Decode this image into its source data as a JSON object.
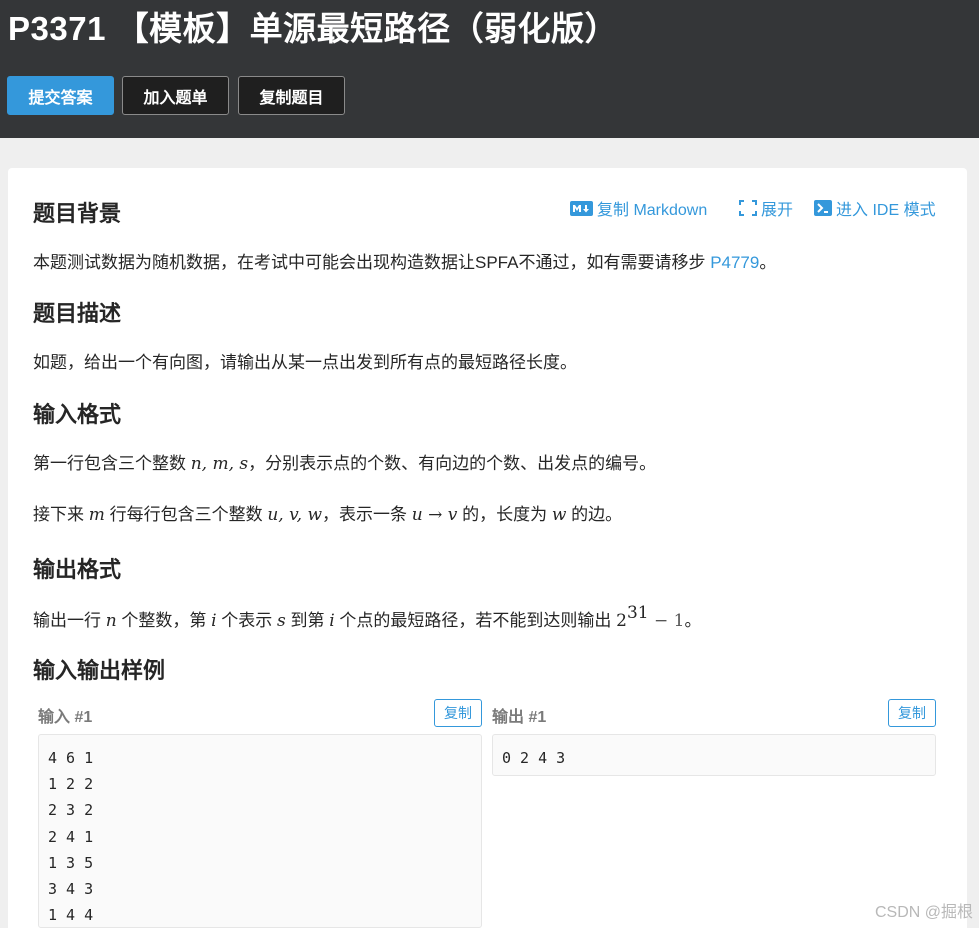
{
  "header": {
    "title": "P3371 【模板】单源最短路径（弱化版）",
    "buttons": {
      "submit": "提交答案",
      "add_to_list": "加入题单",
      "copy_problem": "复制题目"
    }
  },
  "toolbar": {
    "copy_markdown": "复制 Markdown",
    "expand": "展开",
    "ide_mode": "进入 IDE 模式"
  },
  "sections": {
    "background": {
      "heading": "题目背景",
      "text": "本题测试数据为随机数据，在考试中可能会出现构造数据让SPFA不通过，如有需要请移步 ",
      "link": "P4779",
      "end": "。"
    },
    "description": {
      "heading": "题目描述",
      "text": "如题，给出一个有向图，请输出从某一点出发到所有点的最短路径长度。"
    },
    "input_format": {
      "heading": "输入格式",
      "line1": {
        "pre": "第一行包含三个整数 ",
        "math": "n, m, s",
        "post": "，分别表示点的个数、有向边的个数、出发点的编号。"
      },
      "line2": {
        "pre": "接下来 ",
        "m": "m",
        "mid1": " 行每行包含三个整数 ",
        "uvw": "u, v, w",
        "mid2": "，表示一条 ",
        "arrow": "u → v",
        "mid3": " 的，长度为 ",
        "w": "w",
        "post": " 的边。"
      }
    },
    "output_format": {
      "heading": "输出格式",
      "line": {
        "pre": "输出一行 ",
        "n": "n",
        "mid1": " 个整数，第 ",
        "i1": "i",
        "mid2": " 个表示 ",
        "s": "s",
        "mid3": " 到第 ",
        "i2": "i",
        "mid4": " 个点的最短路径，若不能到达则输出 ",
        "base": "2",
        "exp": "31",
        "minus": " − 1",
        "end": "。"
      }
    },
    "samples": {
      "heading": "输入输出样例",
      "input_label": "输入 #1",
      "output_label": "输出 #1",
      "copy_label": "复制",
      "input_lines": [
        "4 6 1",
        "1 2 2",
        "2 3 2",
        "2 4 1",
        "1 3 5",
        "3 4 3",
        "1 4 4"
      ],
      "output_lines": [
        "0 2 4 3"
      ]
    }
  },
  "watermark": "CSDN @掘根",
  "colors": {
    "header_bg": "#343638",
    "accent": "#3498db",
    "page_bg": "#efefef"
  }
}
